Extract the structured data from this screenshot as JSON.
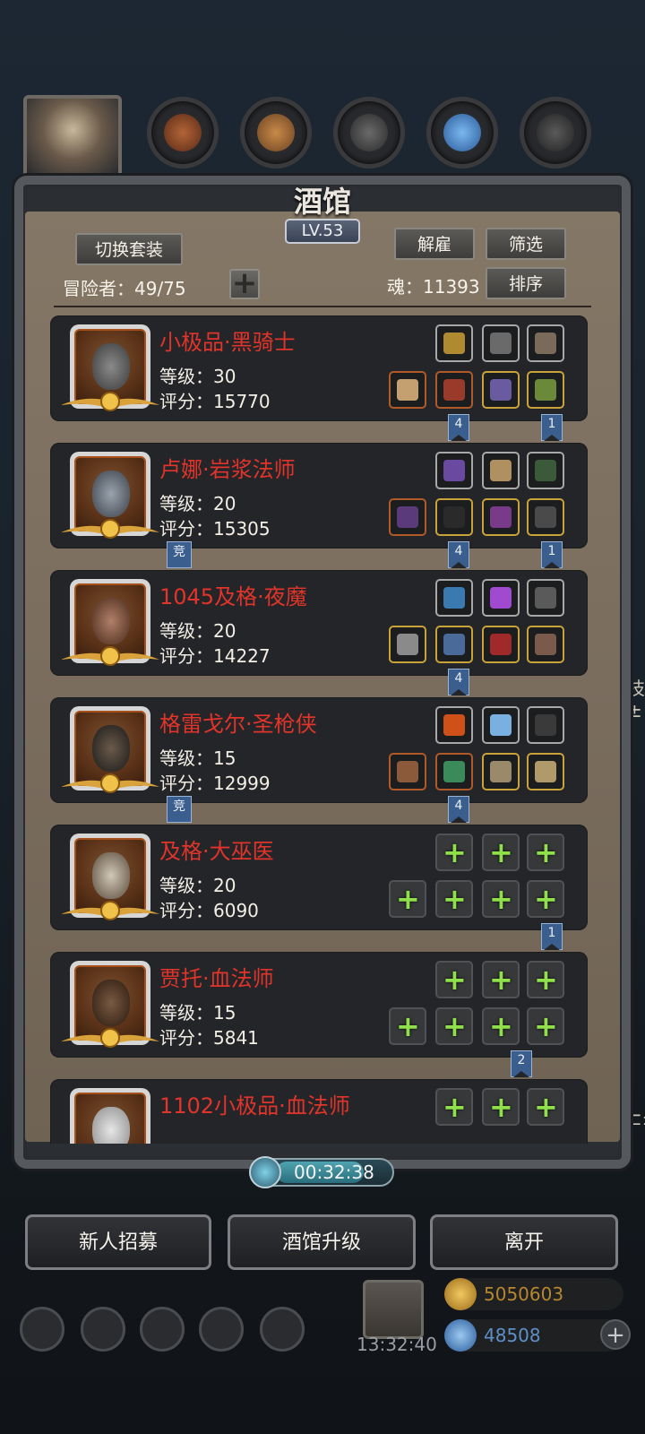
{
  "panel": {
    "title": "酒馆",
    "level": "LV.53",
    "switch_outfit": "切换套装",
    "dismiss": "解雇",
    "filter": "筛选",
    "sort": "排序",
    "adventurers_label": "冒险者：49/75",
    "soul_label": "魂：11393"
  },
  "heroes": [
    {
      "name": "小极品·黑骑士",
      "level": "等级：30",
      "score": "评分：15770",
      "color": "#e1342a"
    },
    {
      "name": "卢娜·岩浆法师",
      "level": "等级：20",
      "score": "评分：15305",
      "color": "#e1342a"
    },
    {
      "name": "1045及格·夜魔",
      "level": "等级：20",
      "score": "评分：14227",
      "color": "#e1342a"
    },
    {
      "name": "格雷戈尔·圣枪侠",
      "level": "等级：15",
      "score": "评分：12999",
      "color": "#e1342a"
    },
    {
      "name": "及格·大巫医",
      "level": "等级：20",
      "score": "评分：6090",
      "color": "#e1342a"
    },
    {
      "name": "贾托·血法师",
      "level": "等级：15",
      "score": "评分：5841",
      "color": "#e1342a"
    },
    {
      "name": "1102小极品·血法师",
      "level": "",
      "score": "",
      "color": "#e1342a"
    }
  ],
  "flags": {
    "four": "4",
    "one": "1",
    "two": "2",
    "compete": "竞"
  },
  "timer": "00:32:38",
  "bottom_buttons": {
    "recruit": "新人招募",
    "upgrade": "酒馆升级",
    "leave": "离开"
  },
  "hud": {
    "time": "13:32:40",
    "gold": "5050603",
    "gems": "48508"
  },
  "background_text": {
    "side1": "技±",
    "side2": "⊏±"
  },
  "colors": {
    "hero_name": "#e1342a",
    "plus_green": "#8fe04a",
    "gold_text": "#b8862e",
    "gem_text": "#5f8fc9"
  }
}
